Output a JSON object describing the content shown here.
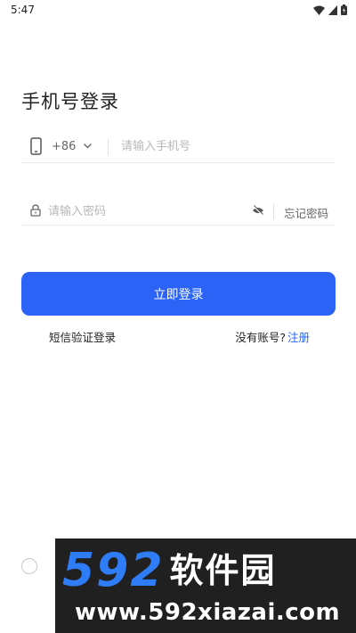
{
  "status_bar": {
    "time": "5:47"
  },
  "login": {
    "title": "手机号登录",
    "country_code": "+86",
    "phone_placeholder": "请输入手机号",
    "password_placeholder": "请输入密码",
    "forgot_password": "忘记密码",
    "login_button": "立即登录",
    "sms_login": "短信验证登录",
    "no_account": "没有账号?",
    "register": "注册"
  },
  "watermark": {
    "numbers": "592",
    "site_name": "软件园",
    "url": "www.592xiazai.com"
  },
  "colors": {
    "accent": "#2a63f5",
    "watermark_bg": "#202020",
    "watermark_blue": "#2f7df6"
  },
  "icons": [
    "wifi-icon",
    "signal-icon",
    "battery-icon",
    "phone-icon",
    "chevron-down-icon",
    "lock-icon",
    "eye-off-icon"
  ]
}
